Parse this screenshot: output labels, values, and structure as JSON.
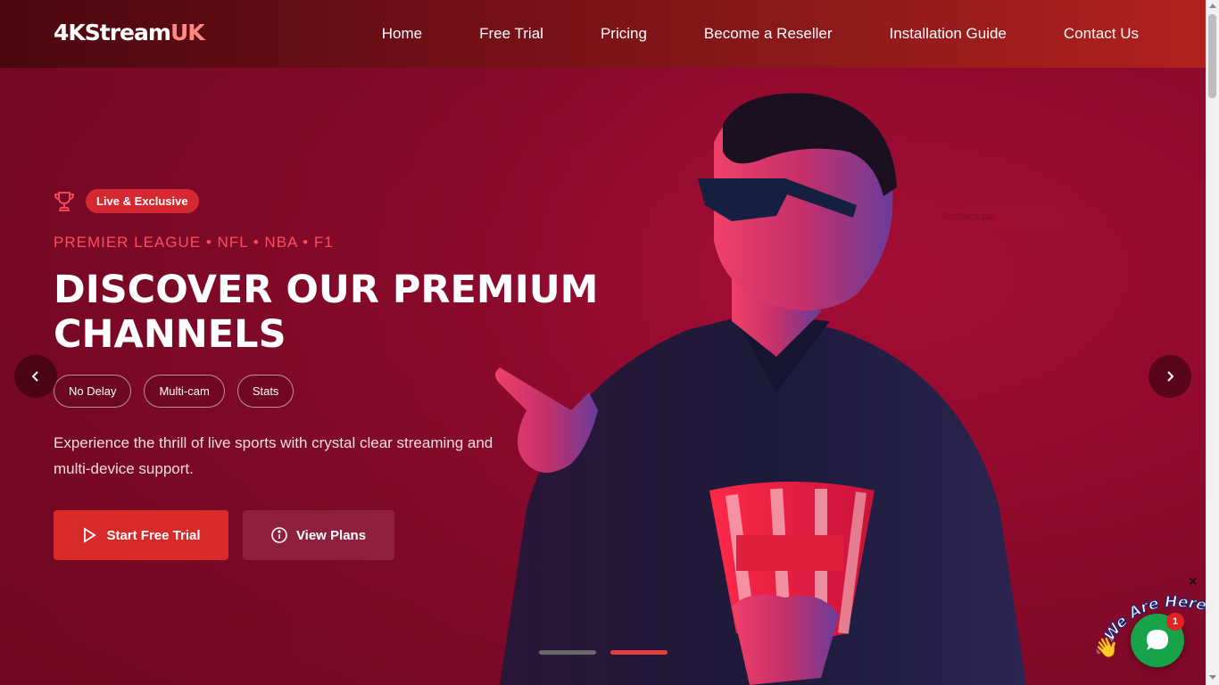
{
  "navbar": {
    "brand_main": "4KStream",
    "brand_accent": "UK",
    "links": [
      "Home",
      "Free Trial",
      "Pricing",
      "Become a Reseller",
      "Installation Guide",
      "Contact Us"
    ]
  },
  "hero": {
    "badge_icon": "trophy-icon",
    "badge": "Live & Exclusive",
    "leagues": "PREMIER LEAGUE • NFL • NBA • F1",
    "headline": "DISCOVER OUR PREMIUM CHANNELS",
    "chips": [
      "No Delay",
      "Multi-cam",
      "Stats"
    ],
    "description": "Experience the thrill of live sports with crystal clear streaming and multi-device support.",
    "primary_button": "Start Free Trial",
    "secondary_button": "View Plans",
    "ghost_text": "Fallback bar",
    "slide_count": 2,
    "active_slide": 2
  },
  "chat": {
    "label": "We Are Here!",
    "unread": "1",
    "close": "×"
  },
  "colors": {
    "accent": "#d92a2a",
    "hero_bg": "#8d0a2d",
    "league_text": "#ff4d5e",
    "chat": "#16a34a"
  }
}
